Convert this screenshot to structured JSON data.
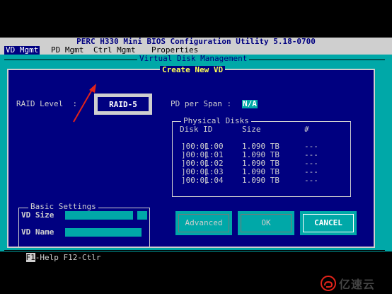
{
  "title_bar": {
    "text": "PERC H330 Mini BIOS Configuration Utility 5.18-0700"
  },
  "menu": {
    "items": [
      {
        "label": "VD Mgmt",
        "active": true
      },
      {
        "label": "PD Mgmt",
        "active": false
      },
      {
        "label": "Ctrl Mgmt",
        "active": false
      },
      {
        "label": "Properties",
        "active": false
      }
    ]
  },
  "panel": {
    "title": "Virtual Disk Management"
  },
  "dialog": {
    "title": "Create New VD",
    "raid_level_label": "RAID Level  :",
    "raid_level_value": "RAID-5",
    "pd_per_span_label": "PD per Span :",
    "pd_per_span_value": "N/A",
    "physical_disks": {
      "title": "Physical Disks",
      "headers": {
        "disk_id": "Disk ID",
        "size": "Size",
        "num": "#"
      },
      "rows": [
        {
          "check": "[",
          "disk_id": "]00:01:00",
          "size": "1.090 TB",
          "num": "---"
        },
        {
          "check": "[",
          "disk_id": "]00:01:01",
          "size": "1.090 TB",
          "num": "---"
        },
        {
          "check": "[",
          "disk_id": "]00:01:02",
          "size": "1.090 TB",
          "num": "---"
        },
        {
          "check": "[",
          "disk_id": "]00:01:03",
          "size": "1.090 TB",
          "num": "---"
        },
        {
          "check": "[",
          "disk_id": "]00:01:04",
          "size": "1.090 TB",
          "num": "---"
        }
      ]
    },
    "basic_settings": {
      "title": "Basic Settings",
      "vd_size_label": "VD Size",
      "vd_name_label": "VD Name"
    },
    "buttons": {
      "advanced": "Advanced",
      "ok": "OK",
      "cancel": "CANCEL"
    }
  },
  "status_bar": {
    "key": "F1",
    "text": "-Help F12-Ctlr"
  },
  "watermark": {
    "text": "亿速云"
  },
  "colors": {
    "navy": "#000080",
    "cyan": "#00a8a8",
    "gray": "#cfcfcf",
    "yellow": "#ffff55",
    "arrow_red": "#e2231a"
  }
}
